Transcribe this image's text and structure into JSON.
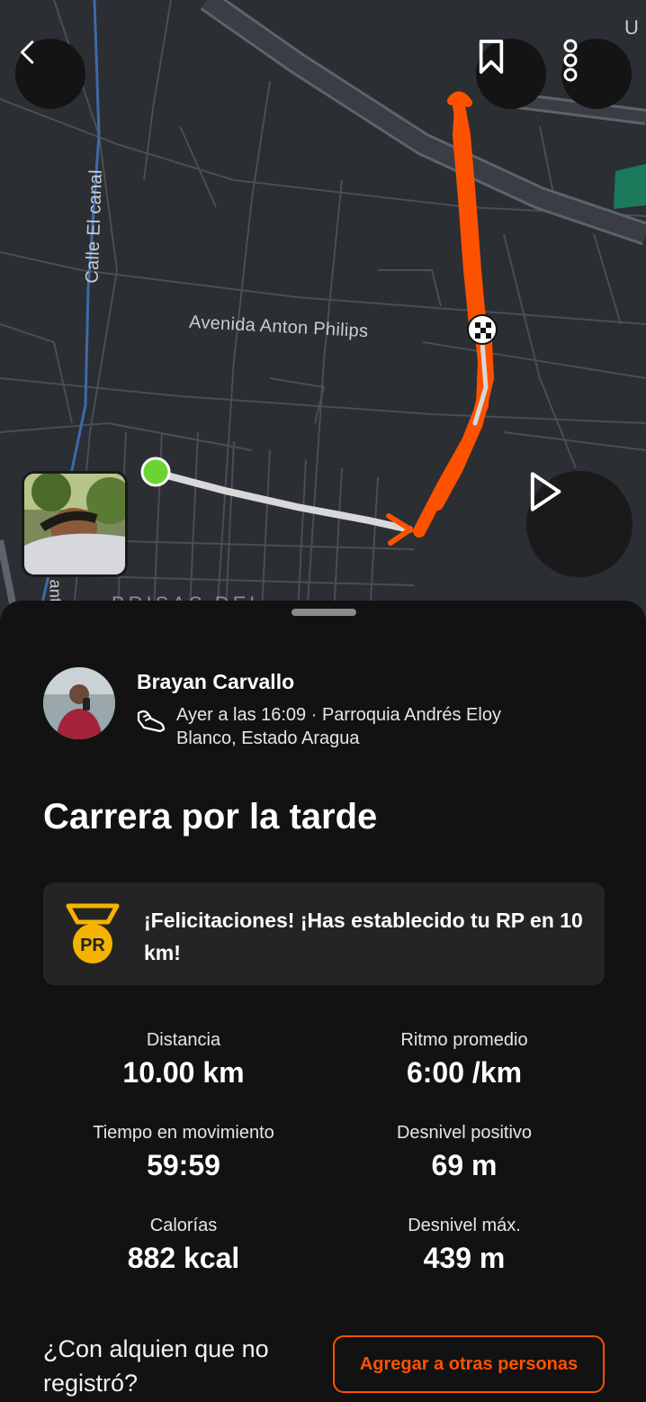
{
  "map": {
    "streets": {
      "calle_el_canal": "Calle El canal",
      "avenida_anton_philips": "Avenida Anton Philips",
      "corner_letter": "U",
      "side_fragment": "ant",
      "bottom_fragment": "BRISAS DEL"
    },
    "route_color": "#fc5200",
    "start_color": "#6cd432"
  },
  "header": {
    "back_icon": "chevron-left-icon",
    "bookmark_icon": "bookmark-icon",
    "more_icon": "more-vertical-icon",
    "play_icon": "play-icon"
  },
  "athlete": {
    "name": "Brayan Carvallo",
    "activity_icon": "running-shoe-icon",
    "meta": "Ayer a las 16:09 · Parroquia Andrés Eloy Blanco, Estado Aragua"
  },
  "activity": {
    "title": "Carrera por la tarde"
  },
  "pr_banner": {
    "icon": "pr-medal-icon",
    "badge_text": "PR",
    "text": "¡Felicitaciones! ¡Has establecido tu RP en 10 km!",
    "accent": "#f5b301"
  },
  "stats": [
    {
      "label": "Distancia",
      "value": "10.00 km"
    },
    {
      "label": "Ritmo promedio",
      "value": "6:00 /km"
    },
    {
      "label": "Tiempo en movimiento",
      "value": "59:59"
    },
    {
      "label": "Desnivel positivo",
      "value": "69 m"
    },
    {
      "label": "Calorías",
      "value": "882 kcal"
    },
    {
      "label": "Desnivel máx.",
      "value": "439 m"
    }
  ],
  "footer": {
    "prompt": "¿Con alquien que no registró?",
    "add_button": "Agregar a otras personas",
    "accent": "#fc5200"
  }
}
